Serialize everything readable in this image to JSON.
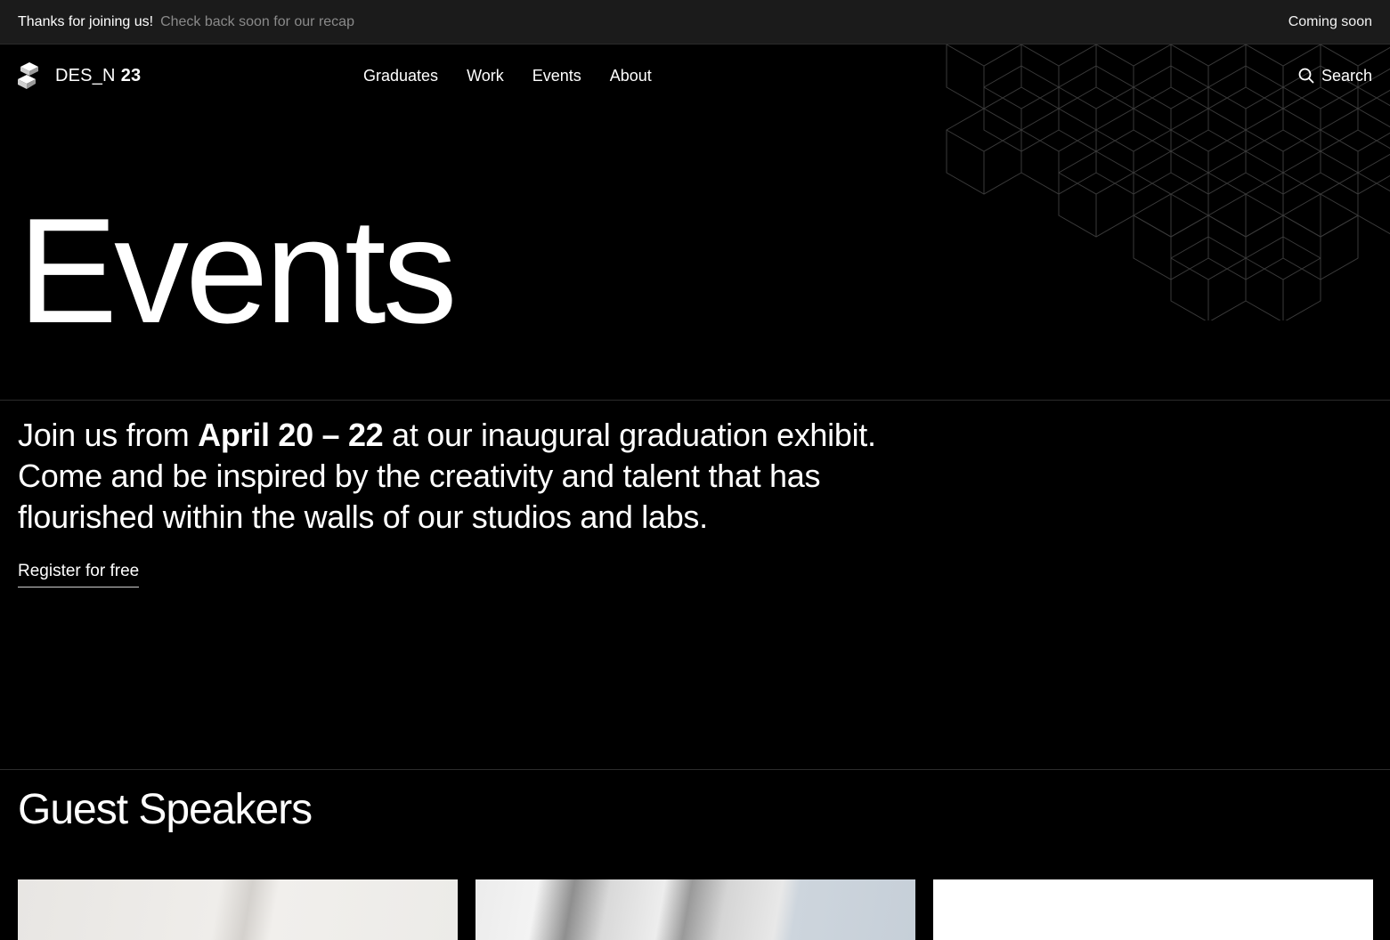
{
  "announcement": {
    "message": "Thanks for joining us!",
    "sub_message": "Check back soon for our recap",
    "status": "Coming soon"
  },
  "nav": {
    "brand": {
      "name": "DES_N",
      "year": "23",
      "logo_icon": "cube-stack-logo"
    },
    "items": [
      {
        "label": "Graduates"
      },
      {
        "label": "Work"
      },
      {
        "label": "Events"
      },
      {
        "label": "About"
      }
    ],
    "search": {
      "label": "Search",
      "icon": "search-icon"
    }
  },
  "hero": {
    "title": "Events"
  },
  "intro": {
    "before": "Join us from ",
    "dates": "April 20 – 22",
    "after": " at our inaugural graduation exhibit. Come and be inspired by the creativity and talent that has flourished within the walls of our studios and labs.",
    "cta": "Register for free"
  },
  "speakers": {
    "title": "Guest Speakers"
  },
  "colors": {
    "background": "#000000",
    "announcement_bar": "#1b1b1b",
    "muted_text": "#8a8a8a",
    "text": "#ffffff"
  }
}
